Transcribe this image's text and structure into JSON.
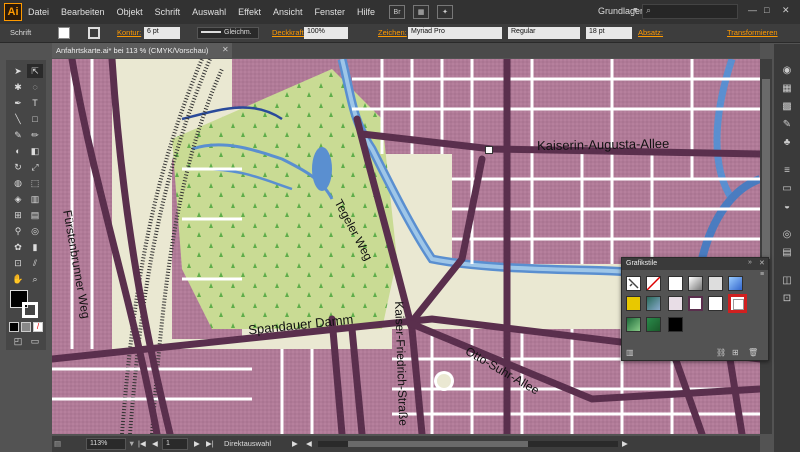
{
  "app": {
    "logo": "Ai"
  },
  "menu": [
    "Datei",
    "Bearbeiten",
    "Objekt",
    "Schrift",
    "Auswahl",
    "Effekt",
    "Ansicht",
    "Fenster",
    "Hilfe"
  ],
  "menu_br_label": "Br",
  "workspace": "Grundlagen",
  "control": {
    "selection_type": "Schrift",
    "kontur_label": "Kontur:",
    "stroke_weight": "6 pt",
    "stroke_profile": "Gleichm.",
    "deckkraft_label": "Deckkraft:",
    "opacity": "100%",
    "zeichen_label": "Zeichen:",
    "font": "Myriad Pro",
    "font_style": "Regular",
    "font_size": "18 pt",
    "absatz_label": "Absatz:",
    "transform_label": "Transformieren"
  },
  "document_tab": "Anfahrtskarte.ai* bei 113 % (CMYK/Vorschau)",
  "status": {
    "zoom": "113%",
    "page": "1",
    "tool": "Direktauswahl"
  },
  "panel": {
    "title": "Grafikstile"
  },
  "map_labels": {
    "kaiserin": "Kaiserin-Augusta-Allee",
    "tegeler": "Tegeler Weg",
    "fuersten": "Fürstenbrunner Weg",
    "spandauer": "Spandauer Damm",
    "kaiser_friedrich": "Kaiser-Friedrich-Straße",
    "otto": "Otto-Suhr-Allee"
  },
  "colors": {
    "accent": "#ff9a00",
    "block": "#b07a97",
    "road": "#5a2f4d",
    "water": "#5a8fd0",
    "park": "#c9db94"
  }
}
